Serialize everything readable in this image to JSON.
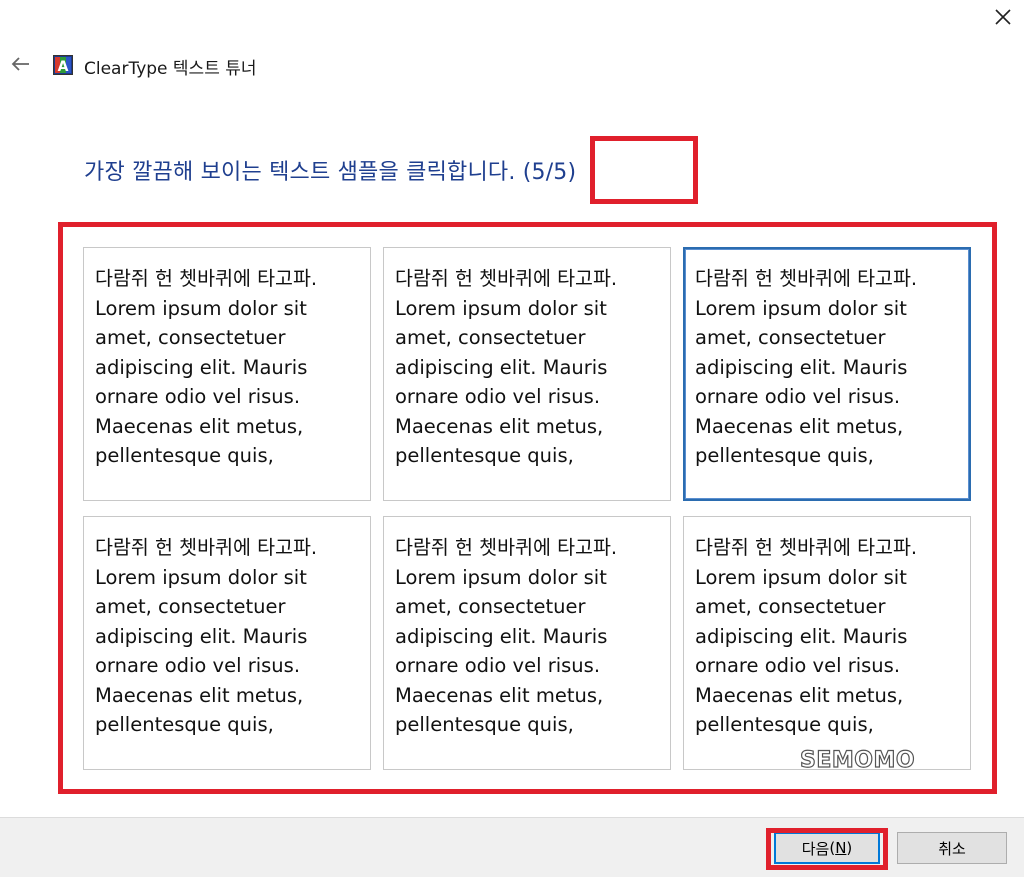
{
  "window": {
    "title": "ClearType 텍스트 튜너",
    "close_icon": "close-icon",
    "back_icon": "back-arrow-icon",
    "app_icon": "cleartype-app-icon"
  },
  "main": {
    "instruction": "가장 깔끔해 보이는 텍스트 샘플을 클릭합니다. (5/5)",
    "selected_sample_index": 2,
    "samples": [
      {
        "text": "다람쥐 헌 쳇바퀴에 타고파. Lorem ipsum dolor sit amet, consectetuer adipiscing elit. Mauris ornare odio vel risus. Maecenas elit metus, pellentesque quis,"
      },
      {
        "text": "다람쥐 헌 쳇바퀴에 타고파. Lorem ipsum dolor sit amet, consectetuer adipiscing elit. Mauris ornare odio vel risus. Maecenas elit metus, pellentesque quis,"
      },
      {
        "text": "다람쥐 헌 쳇바퀴에 타고파. Lorem ipsum dolor sit amet, consectetuer adipiscing elit. Mauris ornare odio vel risus. Maecenas elit metus, pellentesque quis,"
      },
      {
        "text": "다람쥐 헌 쳇바퀴에 타고파. Lorem ipsum dolor sit amet, consectetuer adipiscing elit. Mauris ornare odio vel risus. Maecenas elit metus, pellentesque quis,"
      },
      {
        "text": "다람쥐 헌 쳇바퀴에 타고파. Lorem ipsum dolor sit amet, consectetuer adipiscing elit. Mauris ornare odio vel risus. Maecenas elit metus, pellentesque quis,"
      },
      {
        "text": "다람쥐 헌 쳇바퀴에 타고파. Lorem ipsum dolor sit amet, consectetuer adipiscing elit. Mauris ornare odio vel risus. Maecenas elit metus, pellentesque quis,"
      }
    ]
  },
  "footer": {
    "next_label": "다음",
    "next_accesskey": "N",
    "cancel_label": "취소"
  },
  "watermark": "SEMOMO",
  "colors": {
    "annotation_red": "#e0202c",
    "instruction_blue": "#1f3f8f",
    "selection_blue": "#2b6cb0"
  }
}
